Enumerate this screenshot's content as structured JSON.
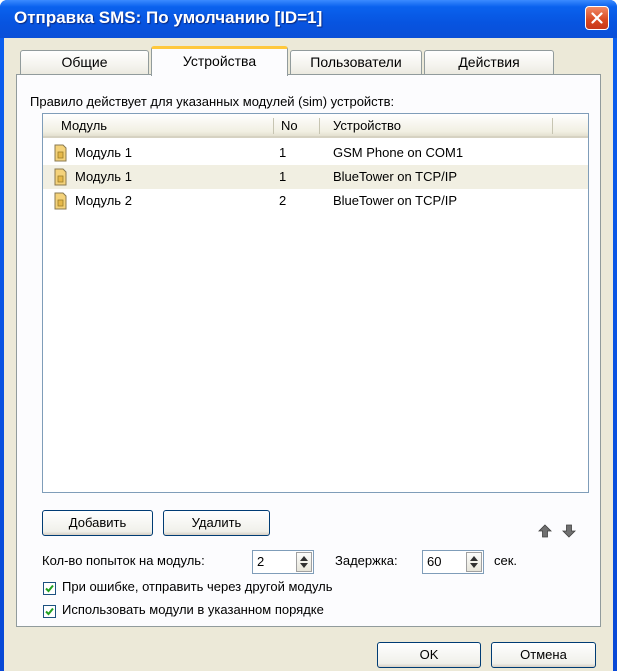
{
  "window": {
    "title": "Отправка SMS: По умолчанию [ID=1]"
  },
  "tabs": [
    {
      "label": "Общие",
      "active": false
    },
    {
      "label": "Устройства",
      "active": true
    },
    {
      "label": "Пользователи",
      "active": false
    },
    {
      "label": "Действия",
      "active": false
    }
  ],
  "rule_label": "Правило действует для указанных модулей (sim) устройств:",
  "list": {
    "columns": [
      "Модуль",
      "No",
      "Устройство"
    ],
    "rows": [
      {
        "module": "Модуль 1",
        "no": "1",
        "device": "GSM Phone on COM1",
        "selected": false
      },
      {
        "module": "Модуль 1",
        "no": "1",
        "device": "BlueTower on TCP/IP",
        "selected": true
      },
      {
        "module": "Модуль 2",
        "no": "2",
        "device": "BlueTower on TCP/IP",
        "selected": false
      }
    ]
  },
  "buttons": {
    "add": "Добавить",
    "remove": "Удалить",
    "ok": "OK",
    "cancel": "Отмена"
  },
  "attempts": {
    "label": "Кол-во попыток на модуль:",
    "value": "2"
  },
  "delay": {
    "label": "Задержка:",
    "value": "60",
    "unit": "сек."
  },
  "options": [
    {
      "label": "При ошибке, отправить через другой модуль",
      "checked": true
    },
    {
      "label": "Использовать модули в указанном порядке",
      "checked": true
    }
  ],
  "icons": {
    "close": "close-icon",
    "module": "sim-module-icon",
    "up": "arrow-up-icon",
    "down": "arrow-down-icon",
    "spin": "spin-updown-icon",
    "check": "checkmark-icon"
  },
  "colors": {
    "titlebar": "#0a5ff0",
    "close_button": "#d8481f",
    "active_tab_accent": "#ffc83c",
    "face": "#ece9d8",
    "checkmark": "#21a121"
  }
}
